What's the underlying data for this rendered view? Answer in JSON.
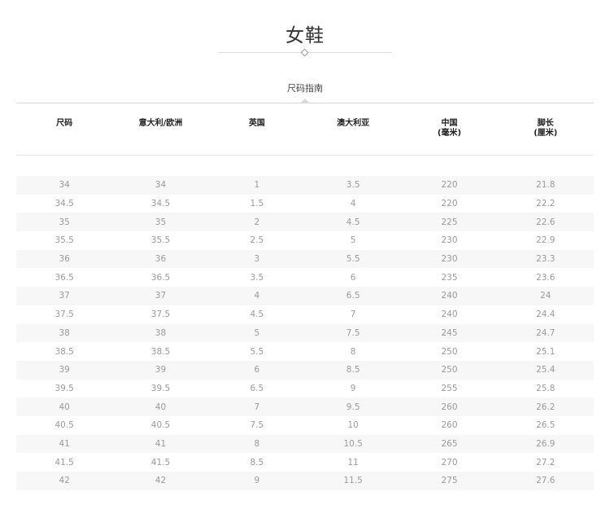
{
  "page": {
    "title": "女鞋",
    "subtitle": "尺码指南"
  },
  "table": {
    "headers": [
      {
        "line1": "尺码",
        "line2": ""
      },
      {
        "line1": "意大利/欧洲",
        "line2": ""
      },
      {
        "line1": "英国",
        "line2": ""
      },
      {
        "line1": "澳大利亚",
        "line2": ""
      },
      {
        "line1": "中国",
        "line2": "(毫米)"
      },
      {
        "line1": "脚长",
        "line2": "(厘米)"
      }
    ],
    "rows": [
      [
        "34",
        "34",
        "1",
        "3.5",
        "220",
        "21.8"
      ],
      [
        "34.5",
        "34.5",
        "1.5",
        "4",
        "220",
        "22.2"
      ],
      [
        "35",
        "35",
        "2",
        "4.5",
        "225",
        "22.6"
      ],
      [
        "35.5",
        "35.5",
        "2.5",
        "5",
        "230",
        "22.9"
      ],
      [
        "36",
        "36",
        "3",
        "5.5",
        "230",
        "23.3"
      ],
      [
        "36.5",
        "36.5",
        "3.5",
        "6",
        "235",
        "23.6"
      ],
      [
        "37",
        "37",
        "4",
        "6.5",
        "240",
        "24"
      ],
      [
        "37.5",
        "37.5",
        "4.5",
        "7",
        "240",
        "24.4"
      ],
      [
        "38",
        "38",
        "5",
        "7.5",
        "245",
        "24.7"
      ],
      [
        "38.5",
        "38.5",
        "5.5",
        "8",
        "250",
        "25.1"
      ],
      [
        "39",
        "39",
        "6",
        "8.5",
        "250",
        "25.4"
      ],
      [
        "39.5",
        "39.5",
        "6.5",
        "9",
        "255",
        "25.8"
      ],
      [
        "40",
        "40",
        "7",
        "9.5",
        "260",
        "26.2"
      ],
      [
        "40.5",
        "40.5",
        "7.5",
        "10",
        "260",
        "26.5"
      ],
      [
        "41",
        "41",
        "8",
        "10.5",
        "265",
        "26.9"
      ],
      [
        "41.5",
        "41.5",
        "8.5",
        "11",
        "270",
        "27.2"
      ],
      [
        "42",
        "42",
        "9",
        "11.5",
        "275",
        "27.6"
      ]
    ]
  }
}
